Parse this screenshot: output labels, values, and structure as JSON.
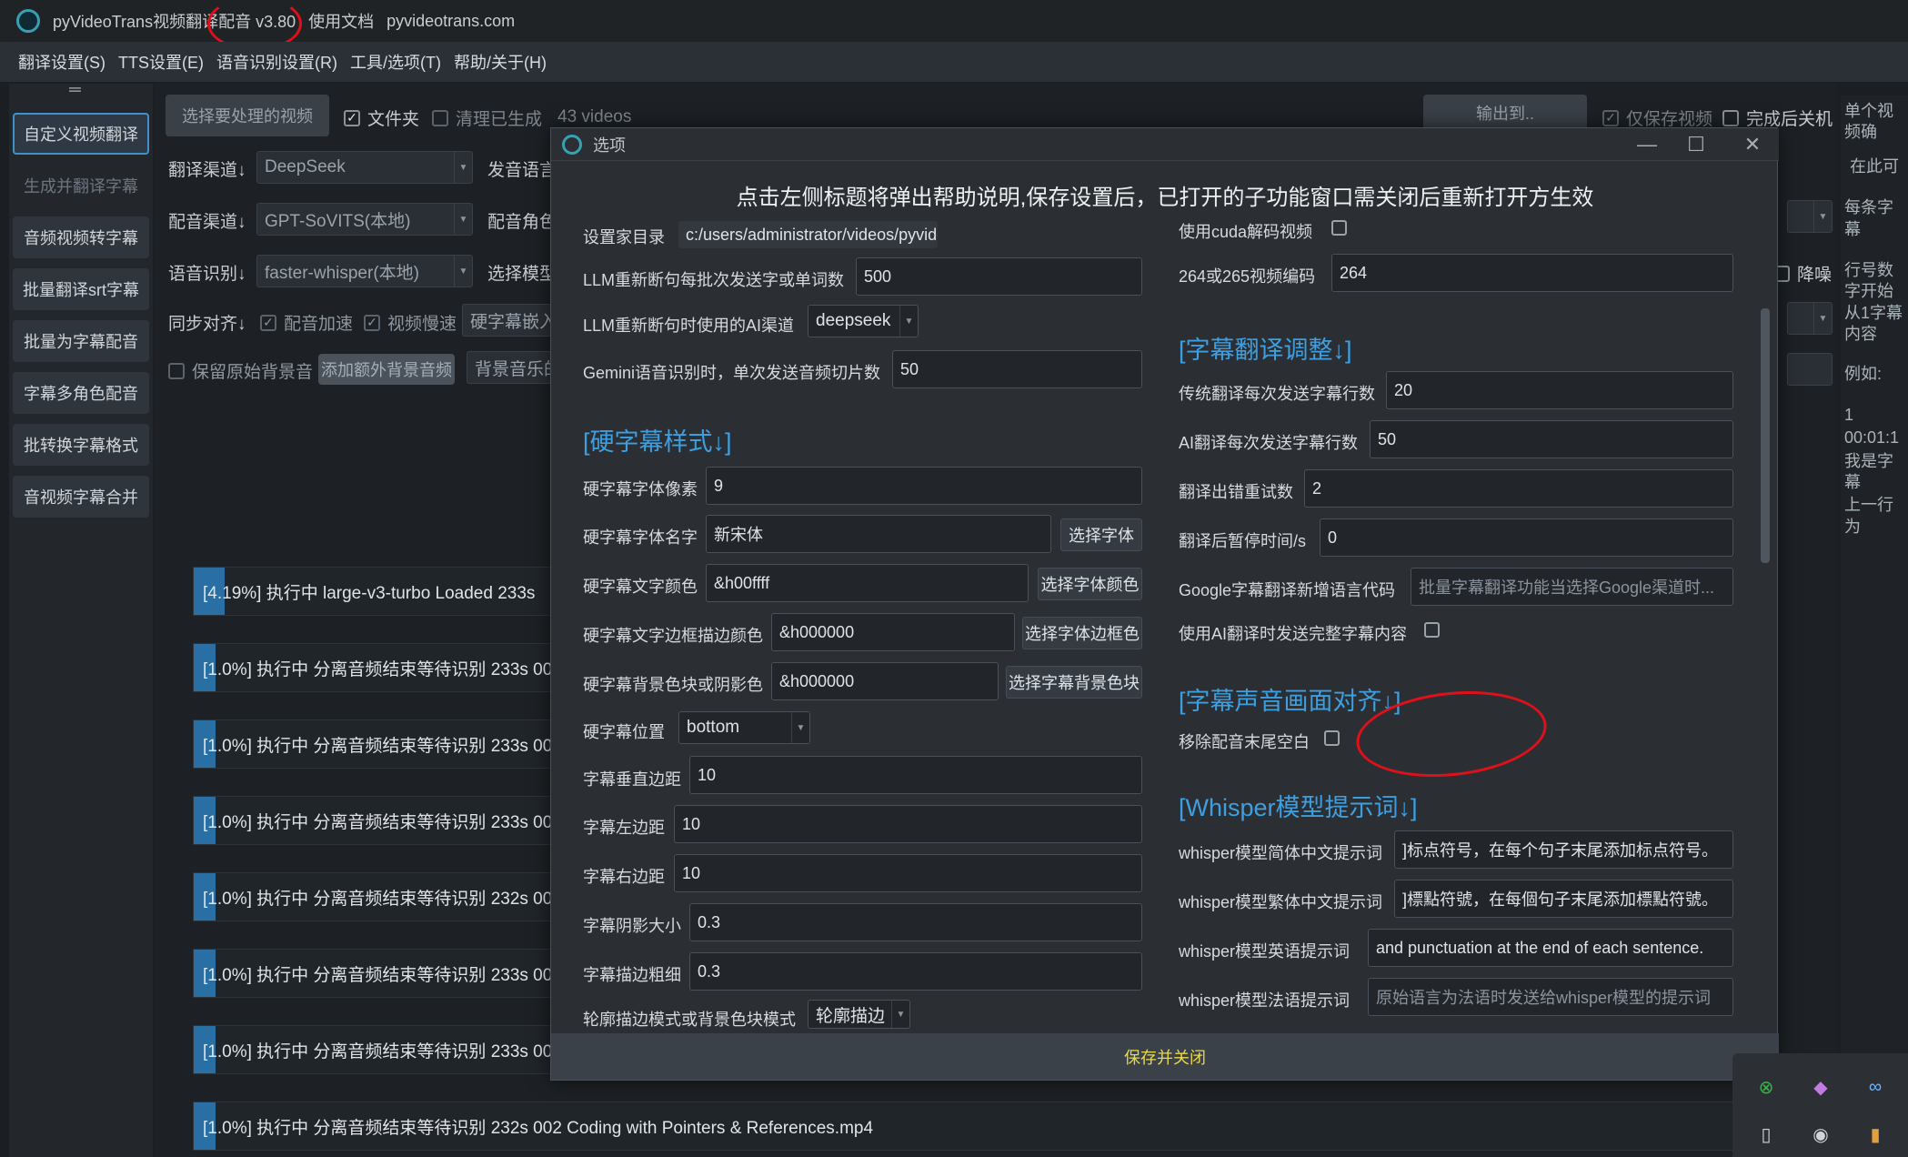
{
  "window": {
    "title": "pyVideoTrans视频翻译配音 v3.80",
    "links": [
      "使用文档",
      "pyvideotrans.com"
    ]
  },
  "menu": [
    "翻译设置(S)",
    "TTS设置(E)",
    "语音识别设置(R)",
    "工具/选项(T)",
    "帮助/关于(H)"
  ],
  "nav": {
    "handle": "═",
    "items": [
      "自定义视频翻译",
      "生成并翻译字幕",
      "音频视频转字幕",
      "批量翻译srt字幕",
      "批量为字幕配音",
      "字幕多角色配音",
      "批转换字幕格式",
      "音视频字幕合并"
    ]
  },
  "main": {
    "select_videos": "选择要处理的视频",
    "folder_label": "文件夹",
    "clear_label": "清理已生成",
    "video_count": "43 videos",
    "output_btn": "输出到..",
    "only_video": "仅保存视频",
    "shutdown": "完成后关机",
    "translate_channel_label": "翻译渠道↓",
    "translate_channel": "DeepSeek",
    "source_lang_label": "发音语言",
    "dub_channel_label": "配音渠道↓",
    "dub_channel": "GPT-SoVITS(本地)",
    "dub_role_label": "配音角色",
    "asr_label": "语音识别↓",
    "asr": "faster-whisper(本地)",
    "model_label": "选择模型",
    "sync_label": "同步对齐↓",
    "dub_speed": "配音加速",
    "video_slow": "视频慢速",
    "hard_sub": "硬字幕嵌入",
    "keep_bg": "保留原始背景音",
    "add_bg_btn": "添加额外背景音频",
    "bg_music": "背景音乐的",
    "denoise": "降噪",
    "tasks": [
      {
        "text": "[4.19%]  执行中 large-v3-turbo Loaded 233s",
        "progress": 0.0419
      },
      {
        "text": "[1.0%]  执行中 分离音频结束等待识别 233s  00",
        "progress": 0.01
      },
      {
        "text": "[1.0%]  执行中 分离音频结束等待识别 233s  00",
        "progress": 0.01
      },
      {
        "text": "[1.0%]  执行中 分离音频结束等待识别 233s  00",
        "progress": 0.01
      },
      {
        "text": "[1.0%]  执行中 分离音频结束等待识别 232s  00",
        "progress": 0.01
      },
      {
        "text": "[1.0%]  执行中 分离音频结束等待识别 233s  00",
        "progress": 0.01
      },
      {
        "text": "[1.0%]  执行中 分离音频结束等待识别 233s  00",
        "progress": 0.01
      },
      {
        "text": "[1.0%]  执行中 分离音频结束等待识别 232s  002 Coding with Pointers & References.mp4",
        "progress": 0.01
      }
    ]
  },
  "right_panel": {
    "text": [
      "单个视频确",
      "在此可",
      "每条字幕",
      "行号数字开始从1字幕内容",
      "例如:",
      "1",
      "00:01:1",
      "我是字幕",
      "上一行为"
    ]
  },
  "dialog": {
    "title": "选项",
    "hint": "点击左侧标题将弹出帮助说明,保存设置后，已打开的子功能窗口需关闭后重新打开方生效",
    "home_dir_label": "设置家目录",
    "home_dir": "c:/users/administrator/videos/pyvideotrans",
    "llm_batch_label": "LLM重新断句每批次发送字或单词数",
    "llm_batch": "500",
    "llm_ai_label": "LLM重新断句时使用的AI渠道",
    "llm_ai": "deepseek",
    "gemini_label": "Gemini语音识别时，单次发送音频切片数",
    "gemini": "50",
    "hard_sub_section": "[硬字幕样式↓]",
    "font_size_label": "硬字幕字体像素",
    "font_size": "9",
    "font_name_label": "硬字幕字体名字",
    "font_name": "新宋体",
    "font_name_btn": "选择字体",
    "font_color_label": "硬字幕文字颜色",
    "font_color": "&h00ffff",
    "font_color_btn": "选择字体颜色",
    "outline_color_label": "硬字幕文字边框描边颜色",
    "outline_color": "&h000000",
    "outline_color_btn": "选择字体边框色",
    "bg_color_label": "硬字幕背景色块或阴影色",
    "bg_color": "&h000000",
    "bg_color_btn": "选择字幕背景色块",
    "position_label": "硬字幕位置",
    "position": "bottom",
    "v_margin_label": "字幕垂直边距",
    "v_margin": "10",
    "l_margin_label": "字幕左边距",
    "l_margin": "10",
    "r_margin_label": "字幕右边距",
    "r_margin": "10",
    "shadow_label": "字幕阴影大小",
    "shadow": "0.3",
    "outline_label": "字幕描边粗细",
    "outline": "0.3",
    "border_mode_label": "轮廓描边模式或背景色块模式",
    "border_mode": "轮廓描边",
    "cuda_label": "使用cuda解码视频",
    "codec_label": "264或265视频编码",
    "codec": "264",
    "trans_section": "[字幕翻译调整↓]",
    "trad_lines_label": "传统翻译每次发送字幕行数",
    "trad_lines": "20",
    "ai_lines_label": "AI翻译每次发送字幕行数",
    "ai_lines": "50",
    "retry_label": "翻译出错重试数",
    "retry": "2",
    "pause_label": "翻译后暂停时间/s",
    "pause": "0",
    "google_label": "Google字幕翻译新增语言代码",
    "google_placeholder": "批量字幕翻译功能当选择Google渠道时...",
    "ai_full_label": "使用AI翻译时发送完整字幕内容",
    "align_section": "[字幕声音画面对齐↓]",
    "remove_tail_label": "移除配音末尾空白",
    "whisper_section": "[Whisper模型提示词↓]",
    "ws_zh_label": "whisper模型简体中文提示词",
    "ws_zh": "]标点符号，在每个句子末尾添加标点符号。",
    "ws_tw_label": "whisper模型繁体中文提示词",
    "ws_tw": "]標點符號，在每個句子末尾添加標點符號。",
    "ws_en_label": "whisper模型英语提示词",
    "ws_en": "and punctuation at the end of each sentence.",
    "ws_fr_label": "whisper模型法语提示词",
    "ws_fr_placeholder": "原始语言为法语时发送给whisper模型的提示词",
    "save_btn": "保存并关闭"
  },
  "colors": {
    "accent": "#3d9fe0",
    "progress": "#2a6fa3",
    "save_text": "#e9d94a",
    "annotation": "#e0101a"
  },
  "tray_icons": [
    "xbox-icon",
    "copilot-icon",
    "glasses-icon",
    "usb-icon",
    "audio-icon",
    "mic-icon"
  ]
}
